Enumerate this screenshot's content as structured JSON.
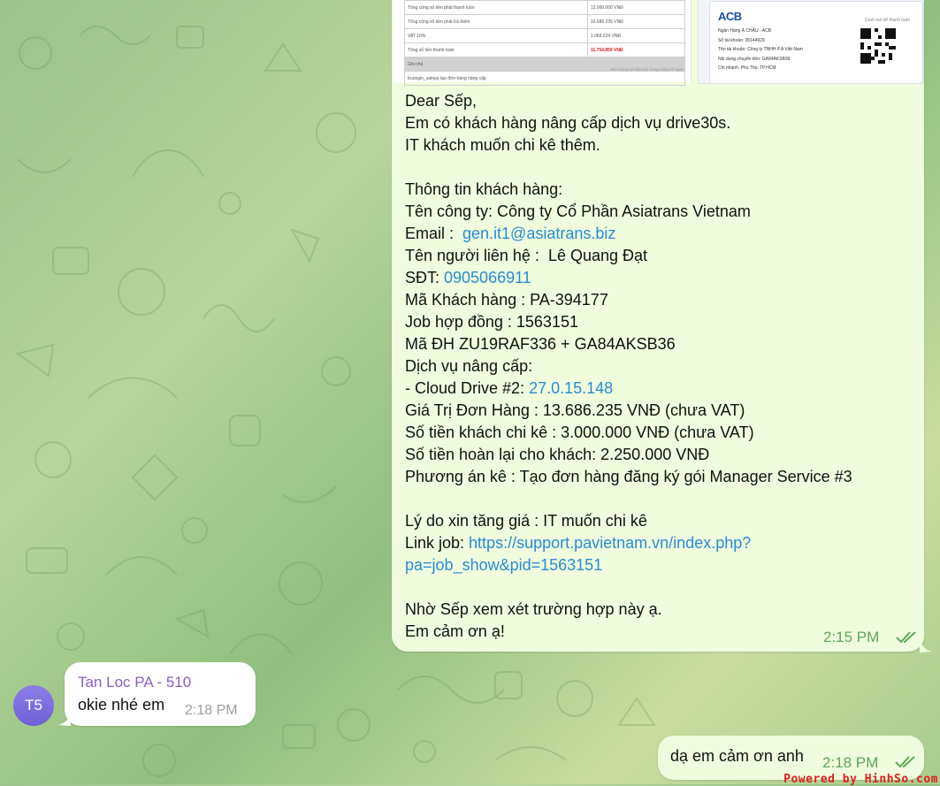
{
  "attachment_invoice": {
    "rows": [
      {
        "label": "Tổng cộng số tiền phải thanh toán",
        "value": "12.000.000 VNĐ"
      },
      {
        "label": "Tổng cộng số tiền phải trả thêm",
        "value": "10.686.235 VNĐ"
      },
      {
        "label": "VAT 10%",
        "value": "1.068.624 VNĐ"
      },
      {
        "label": "Tổng số tiền thanh toán",
        "value": "11.754.859 VNĐ"
      },
      {
        "label": "Ghi chú",
        "value": ""
      },
      {
        "label": "truongle_salepa tạo đơn hàng nâng cấp",
        "value": ""
      }
    ],
    "footnote": "Đơn hàng có hiệu lực trong vòng 07 ngày"
  },
  "attachment_bank": {
    "logo": "ACB",
    "lines": [
      "Ngân Hàng Á CHÂU - ACB",
      "Số tài khoản: 35144929",
      "Tên tài khoản: Công ty TNHH P.A Việt Nam",
      "Nội dung chuyển tiền: GA84AKSB36",
      "Chi nhánh: Phú Thọ, TP.HCM"
    ],
    "qr_caption": "Quét mã để thanh toán"
  },
  "message_main": {
    "lines": [
      {
        "text": "Dear Sếp,"
      },
      {
        "text": "Em có khách hàng nâng cấp dịch vụ drive30s."
      },
      {
        "text": "IT khách muốn chi kê thêm."
      },
      {
        "text": ""
      },
      {
        "text": "Thông tin khách hàng:"
      },
      {
        "text": "Tên công ty: Công ty Cổ Phần Asiatrans Vietnam"
      },
      {
        "text": "Email :  ",
        "link": "gen.it1@asiatrans.biz"
      },
      {
        "text": "Tên người liên hệ :  Lê Quang Đạt"
      },
      {
        "text": "SĐT: ",
        "link": "0905066911"
      },
      {
        "text": "Mã Khách hàng : PA-394177"
      },
      {
        "text": "Job hợp đồng : 1563151"
      },
      {
        "text": "Mã ĐH ZU19RAF336 + GA84AKSB36"
      },
      {
        "text": "Dịch vụ nâng cấp:"
      },
      {
        "text": "- Cloud Drive #2: ",
        "link": "27.0.15.148"
      },
      {
        "text": "Giá Trị Đơn Hàng : 13.686.235 VNĐ (chưa VAT)"
      },
      {
        "text": "Số tiền khách chi kê : 3.000.000 VNĐ (chưa VAT)"
      },
      {
        "text": "Số tiền hoàn lại cho khách: 2.250.000 VNĐ"
      },
      {
        "text": "Phương án kê : Tạo đơn hàng đăng ký gói Manager Service #3"
      },
      {
        "text": ""
      },
      {
        "text": "Lý do xin tăng giá : IT muốn chi kê"
      },
      {
        "text": "Link job: ",
        "link": "https://support.pavietnam.vn/index.php?"
      },
      {
        "text": "",
        "link": "pa=job_show&pid=1563151"
      },
      {
        "text": ""
      },
      {
        "text": "Nhờ Sếp xem xét trường hợp này ạ."
      },
      {
        "text": "Em cảm ơn ạ!"
      }
    ],
    "time": "2:15 PM"
  },
  "message_in": {
    "avatar": "T5",
    "sender": "Tan Loc PA - 510",
    "text": "okie nhé em",
    "time": "2:18 PM"
  },
  "message_out_small": {
    "text": "dạ em cảm ơn anh",
    "time": "2:18 PM"
  },
  "watermark": "Powered by HinhSo.com",
  "colors": {
    "outgoing_bubble": "#effdde",
    "incoming_bubble": "#ffffff",
    "link": "#2a8bd4",
    "time_out": "#5fa656",
    "sender_name": "#8a5ec2"
  }
}
